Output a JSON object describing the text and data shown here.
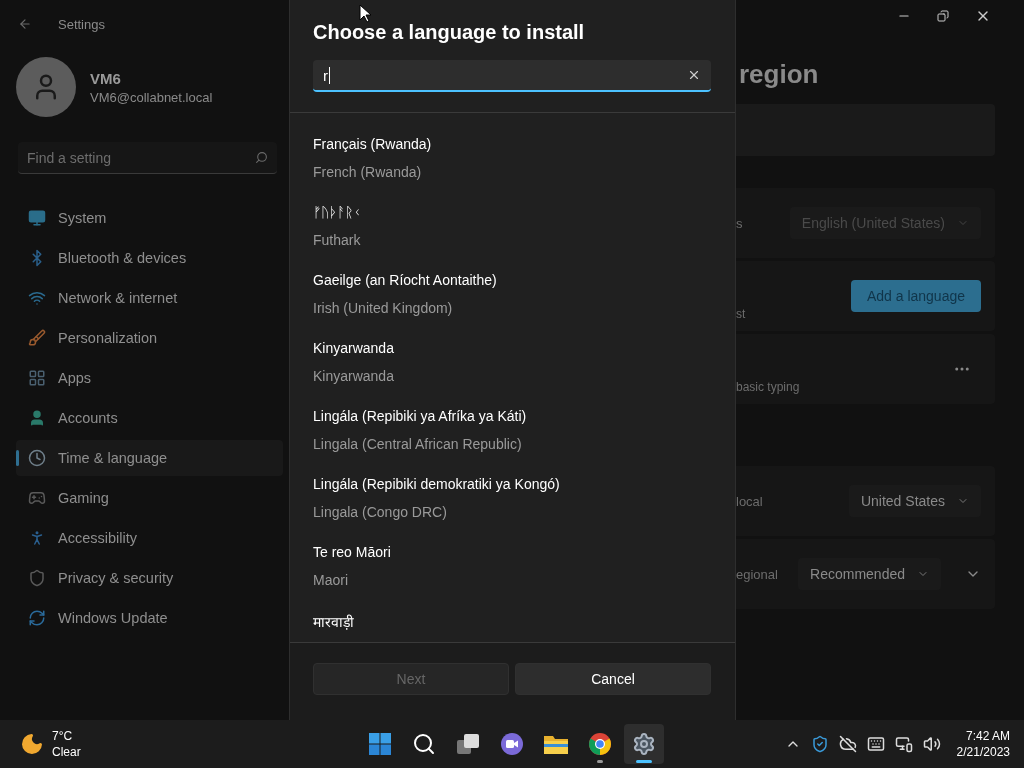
{
  "window": {
    "title": "Settings"
  },
  "account": {
    "name": "VM6",
    "email": "VM6@collabnet.local"
  },
  "search": {
    "placeholder": "Find a setting"
  },
  "nav": [
    {
      "label": "System",
      "kind": "system",
      "selected": false
    },
    {
      "label": "Bluetooth & devices",
      "kind": "bluetooth",
      "selected": false
    },
    {
      "label": "Network & internet",
      "kind": "network",
      "selected": false
    },
    {
      "label": "Personalization",
      "kind": "personalization",
      "selected": false
    },
    {
      "label": "Apps",
      "kind": "apps",
      "selected": false
    },
    {
      "label": "Accounts",
      "kind": "accounts",
      "selected": false
    },
    {
      "label": "Time & language",
      "kind": "time",
      "selected": true
    },
    {
      "label": "Gaming",
      "kind": "gaming",
      "selected": false
    },
    {
      "label": "Accessibility",
      "kind": "accessibility",
      "selected": false
    },
    {
      "label": "Privacy & security",
      "kind": "privacy",
      "selected": false
    },
    {
      "label": "Windows Update",
      "kind": "update",
      "selected": false
    }
  ],
  "page": {
    "title": "region",
    "groups": [
      [
        {
          "kind": "blank"
        }
      ],
      [
        {
          "kind": "dropdown",
          "label": "s",
          "value": "English (United States)",
          "disabled": true,
          "secondary": false
        },
        {
          "kind": "button",
          "label": "st",
          "action": "Add a language",
          "secondary": true
        },
        {
          "kind": "more",
          "label": "basic typing",
          "secondary": true
        }
      ],
      [
        {
          "kind": "dropdown",
          "label": "local",
          "value": "United States",
          "disabled": false,
          "secondary": false
        },
        {
          "kind": "dropdown",
          "label": "egional",
          "value": "Recommended",
          "disabled": false,
          "secondary": false,
          "expandable": true
        }
      ]
    ]
  },
  "dialog": {
    "title": "Choose a language to install",
    "search": {
      "value": "r"
    },
    "languages": [
      {
        "native": "Français (Rwanda)",
        "english": "French (Rwanda)"
      },
      {
        "native": "ᚠᚢᚦᚨᚱᚲ",
        "english": "Futhark"
      },
      {
        "native": "Gaeilge (an Ríocht Aontaithe)",
        "english": "Irish (United Kingdom)"
      },
      {
        "native": "Kinyarwanda",
        "english": "Kinyarwanda"
      },
      {
        "native": "Lingála (Repibiki ya Afríka ya Káti)",
        "english": "Lingala (Central African Republic)"
      },
      {
        "native": "Lingála (Repibiki demokratiki ya Kongó)",
        "english": "Lingala (Congo DRC)"
      },
      {
        "native": "Te reo Māori",
        "english": "Maori"
      },
      {
        "native": "मारवाड़ी"
      }
    ],
    "buttons": [
      {
        "label": "Next",
        "disabled": true
      },
      {
        "label": "Cancel",
        "disabled": false
      }
    ]
  },
  "taskbar": {
    "weather": {
      "temperature": "7°C",
      "condition": "Clear"
    },
    "apps": [
      {
        "kind": "start",
        "running": false,
        "selected": false
      },
      {
        "kind": "search",
        "running": false,
        "selected": false
      },
      {
        "kind": "taskview",
        "running": false,
        "selected": false
      },
      {
        "kind": "chat",
        "running": false,
        "selected": false
      },
      {
        "kind": "explorer",
        "running": false,
        "selected": false
      },
      {
        "kind": "chrome",
        "running": true,
        "selected": false
      },
      {
        "kind": "settings",
        "running": true,
        "selected": true
      }
    ],
    "clock": {
      "time": "7:42 AM",
      "date": "2/21/2023"
    }
  }
}
